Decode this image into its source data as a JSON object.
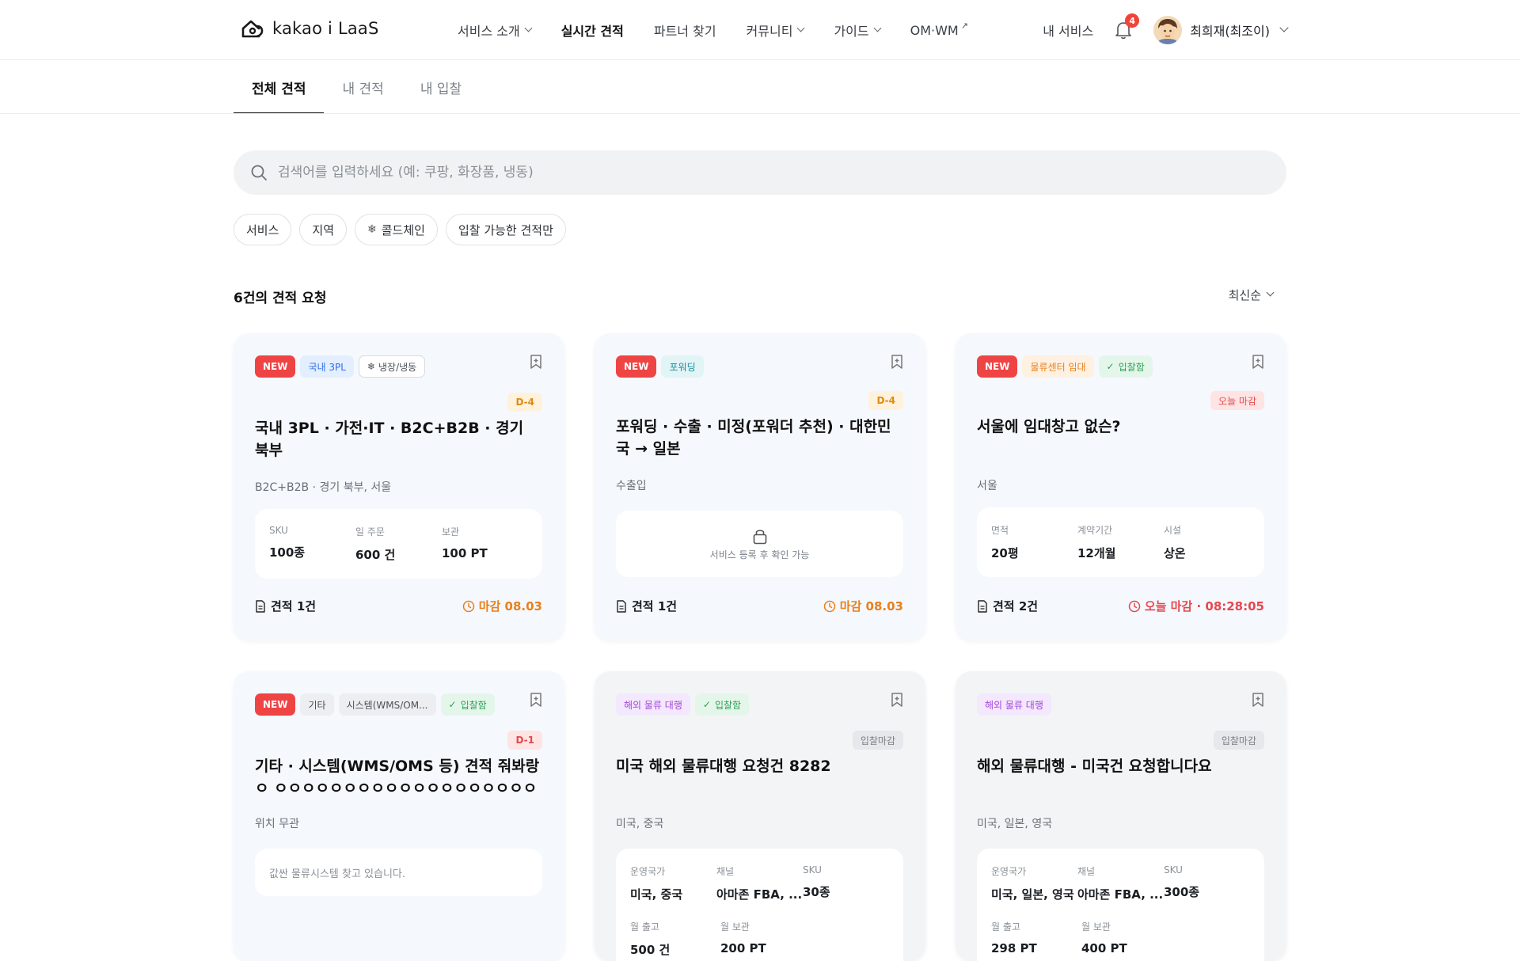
{
  "header": {
    "logo_text": "kakao i LaaS",
    "nav": [
      {
        "label": "서비스 소개"
      },
      {
        "label": "실시간 견적"
      },
      {
        "label": "파트너 찾기"
      },
      {
        "label": "커뮤니티"
      },
      {
        "label": "가이드"
      },
      {
        "label": "OM·WM"
      }
    ],
    "my_service": "내 서비스",
    "notification_count": "4",
    "user_name": "최희재(최조이)"
  },
  "tabs": [
    "전체 견적",
    "내 견적",
    "내 입찰"
  ],
  "search": {
    "placeholder": "검색어를 입력하세요 (예: 쿠팡, 화장품, 냉동)"
  },
  "filters": [
    "서비스",
    "지역",
    "콜드체인",
    "입찰 가능한 견적만"
  ],
  "results": {
    "count_text": "6건의 견적 요청",
    "sort_label": "최신순"
  },
  "cards": [
    {
      "tags": [
        "NEW",
        "국내 3PL",
        "냉장/냉동"
      ],
      "dday": "D-4",
      "title": "국내 3PL · 가전·IT · B2C+B2B · 경기 북부",
      "subtitle": "B2C+B2B · 경기 북부, 서울",
      "info": [
        {
          "label": "SKU",
          "value": "100종"
        },
        {
          "label": "일 주문",
          "value": "600 건"
        },
        {
          "label": "보관",
          "value": "100 PT"
        }
      ],
      "bids": "견적 1건",
      "deadline": "마감 08.03"
    },
    {
      "tags": [
        "NEW",
        "포워딩"
      ],
      "dday": "D-4",
      "title": "포워딩 · 수출 · 미정(포워더 추천) · 대한민국 → 일본",
      "subtitle": "수출입",
      "locked_text": "서비스 등록 후 확인 가능",
      "bids": "견적 1건",
      "deadline": "마감 08.03"
    },
    {
      "tags": [
        "NEW",
        "물류센터 임대",
        "입찰함"
      ],
      "dday": "오늘 마감",
      "title": "서울에 임대창고 없슨?",
      "subtitle": "서울",
      "info": [
        {
          "label": "면적",
          "value": "20평"
        },
        {
          "label": "계약기간",
          "value": "12개월"
        },
        {
          "label": "시설",
          "value": "상온"
        }
      ],
      "bids": "견적 2건",
      "deadline": "오늘 마감 · 08:28:05"
    },
    {
      "tags": [
        "NEW",
        "기타",
        "시스템(WMS/OM...",
        "입찰함"
      ],
      "dday": "D-1",
      "title": "기타 · 시스템(WMS/OMS 등) 견적 줘봐랑ㅇ ㅇㅇㅇㅇㅇㅇㅇㅇㅇㅇㅇㅇㅇㅇㅇㅇㅇㅇㅇㅇㅇ...",
      "subtitle": "위치 무관",
      "note": "값싼 물류시스템 찾고 있습니다."
    },
    {
      "tags": [
        "해외 물류 대행",
        "입찰함"
      ],
      "dday": "입찰마감",
      "title": "미국 해외 물류대행 요청건 8282",
      "subtitle": "미국, 중국",
      "info": [
        {
          "label": "운영국가",
          "value": "미국, 중국"
        },
        {
          "label": "채널",
          "value": "아마존 FBA, ..."
        },
        {
          "label": "SKU",
          "value": "30종"
        },
        {
          "label": "월 출고",
          "value": "500 건"
        },
        {
          "label": "월 보관",
          "value": "200 PT"
        }
      ]
    },
    {
      "tags": [
        "해외 물류 대행"
      ],
      "dday": "입찰마감",
      "title": "해외 물류대행 - 미국건 요청합니다요",
      "subtitle": "미국, 일본, 영국",
      "info": [
        {
          "label": "운영국가",
          "value": "미국, 일본, 영국"
        },
        {
          "label": "채널",
          "value": "아마존 FBA, ..."
        },
        {
          "label": "SKU",
          "value": "300종"
        },
        {
          "label": "월 출고",
          "value": "298 PT"
        },
        {
          "label": "월 보관",
          "value": "400 PT"
        }
      ]
    }
  ]
}
